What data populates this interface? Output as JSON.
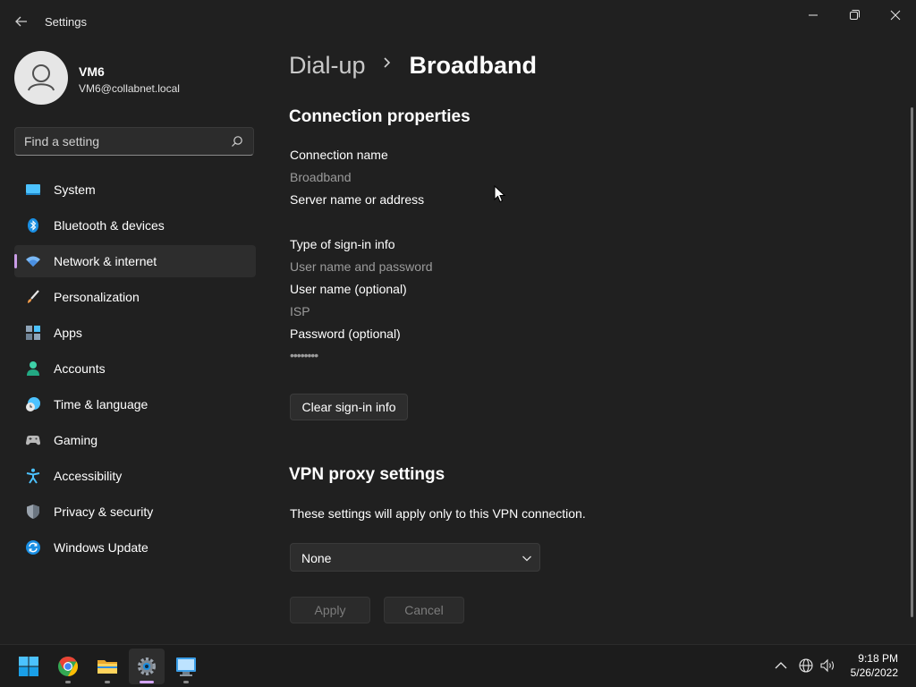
{
  "window": {
    "title": "Settings"
  },
  "profile": {
    "name": "VM6",
    "email": "VM6@collabnet.local"
  },
  "search": {
    "placeholder": "Find a setting"
  },
  "sidebar": {
    "items": [
      {
        "label": "System",
        "icon": "system-icon",
        "active": false
      },
      {
        "label": "Bluetooth & devices",
        "icon": "bluetooth-icon",
        "active": false
      },
      {
        "label": "Network & internet",
        "icon": "wifi-icon",
        "active": true
      },
      {
        "label": "Personalization",
        "icon": "brush-icon",
        "active": false
      },
      {
        "label": "Apps",
        "icon": "apps-icon",
        "active": false
      },
      {
        "label": "Accounts",
        "icon": "accounts-icon",
        "active": false
      },
      {
        "label": "Time & language",
        "icon": "time-language-icon",
        "active": false
      },
      {
        "label": "Gaming",
        "icon": "gamepad-icon",
        "active": false
      },
      {
        "label": "Accessibility",
        "icon": "accessibility-icon",
        "active": false
      },
      {
        "label": "Privacy & security",
        "icon": "shield-icon",
        "active": false
      },
      {
        "label": "Windows Update",
        "icon": "update-icon",
        "active": false
      }
    ]
  },
  "breadcrumb": {
    "parent": "Dial-up",
    "current": "Broadband"
  },
  "connection": {
    "heading": "Connection properties",
    "connection_name_label": "Connection name",
    "connection_name_value": "Broadband",
    "server_label": "Server name or address",
    "server_value": "",
    "signin_type_label": "Type of sign-in info",
    "signin_type_value": "User name and password",
    "username_label": "User name (optional)",
    "username_value": "ISP",
    "password_label": "Password (optional)",
    "password_value": "••••••••",
    "clear_button": "Clear sign-in info"
  },
  "vpn": {
    "heading": "VPN proxy settings",
    "description": "These settings will apply only to this VPN connection.",
    "proxy_selected": "None"
  },
  "actions": {
    "apply": "Apply",
    "cancel": "Cancel"
  },
  "taskbar": {
    "apps": [
      "start-icon",
      "chrome-icon",
      "file-explorer-icon",
      "settings-icon",
      "remote-desktop-icon"
    ],
    "time": "9:18 PM",
    "date": "5/26/2022"
  },
  "colors": {
    "background": "#202020",
    "accent": "#c99ce6",
    "muted_text": "#9b9b9b"
  }
}
